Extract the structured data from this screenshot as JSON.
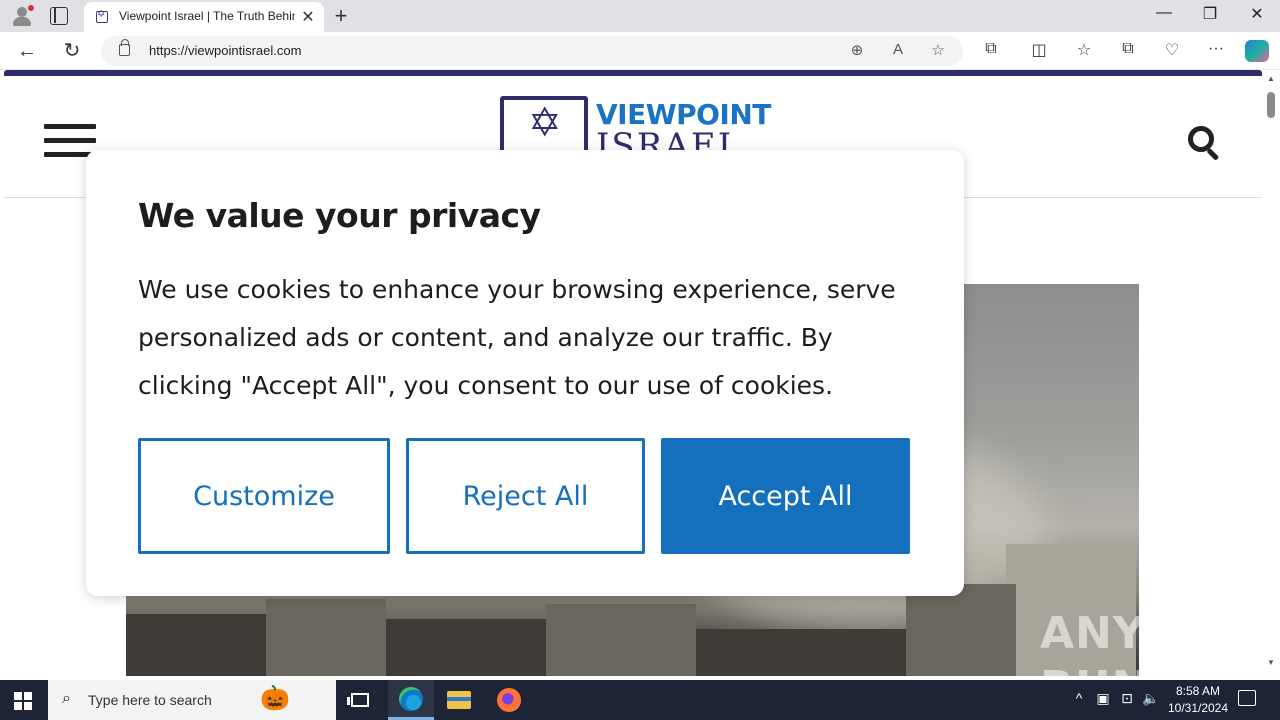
{
  "browser": {
    "tab_title": "Viewpoint Israel | The Truth Behind",
    "tab_close": "✕",
    "new_tab": "+",
    "url": "https://viewpointisrael.com",
    "window_controls": {
      "minimize": "—",
      "maximize": "❐",
      "close": "✕"
    },
    "nav": {
      "back": "←",
      "refresh": "↻"
    },
    "url_icons": [
      "zoom-icon",
      "read-aloud-icon",
      "favorite-star-icon"
    ],
    "toolbar_icons": [
      "extensions-icon",
      "split-screen-icon",
      "favorites-icon",
      "collections-icon",
      "browser-essentials-icon",
      "more-menu-icon",
      "copilot-icon"
    ]
  },
  "site": {
    "logo_word1": "VIEWPOINT",
    "logo_word2": "ISRAEL",
    "brand_color": "#2f2c6b",
    "accent_color": "#1a73c4"
  },
  "cookie_modal": {
    "heading": "We value your privacy",
    "body": "We use cookies to enhance your browsing experience, serve personalized ads or content, and analyze our traffic. By clicking \"Accept All\", you consent to our use of cookies.",
    "customize_label": "Customize",
    "reject_label": "Reject All",
    "accept_label": "Accept All",
    "button_color": "#1470bd"
  },
  "watermark": {
    "left": "ANY",
    "right": "RUN"
  },
  "taskbar": {
    "search_placeholder": "Type here to search",
    "time": "8:58 AM",
    "date": "10/31/2024",
    "apps": [
      "task-view-icon",
      "edge-icon",
      "file-explorer-icon",
      "firefox-icon"
    ],
    "tray_icons": [
      "chevron-up-icon",
      "network-adapter-icon",
      "network-icon",
      "volume-icon"
    ]
  }
}
